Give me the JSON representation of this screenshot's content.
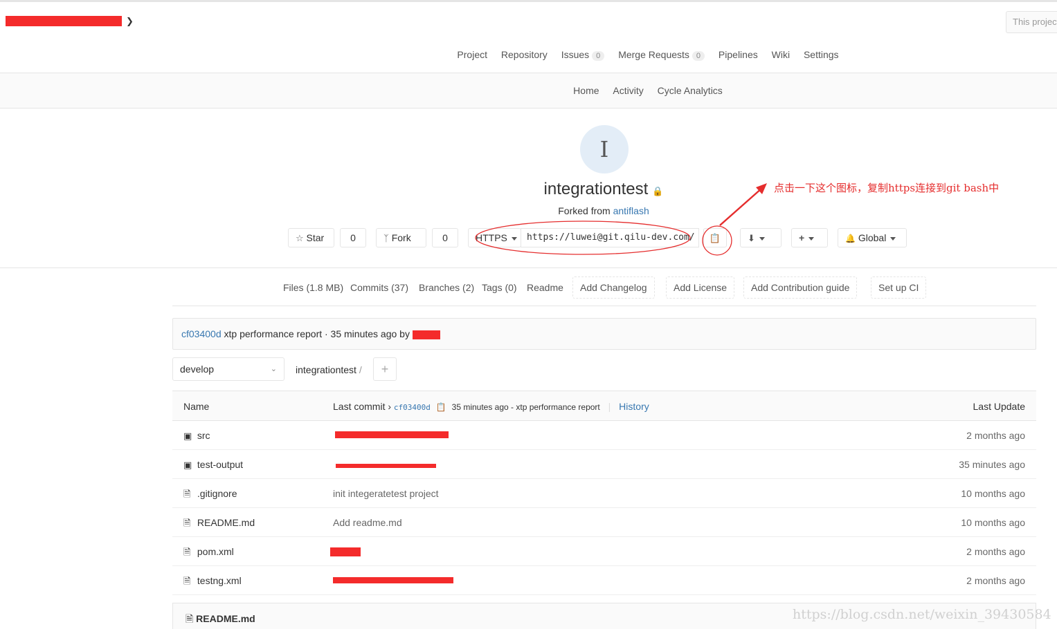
{
  "topbar": {
    "group_chevron_icon": "chevron-down-icon",
    "search_placeholder": "This project"
  },
  "project_nav": {
    "items": [
      {
        "label": "Project"
      },
      {
        "label": "Repository"
      },
      {
        "label": "Issues",
        "count": "0"
      },
      {
        "label": "Merge Requests",
        "count": "0"
      },
      {
        "label": "Pipelines"
      },
      {
        "label": "Wiki"
      },
      {
        "label": "Settings"
      }
    ]
  },
  "sub_nav": {
    "items": [
      {
        "label": "Home"
      },
      {
        "label": "Activity"
      },
      {
        "label": "Cycle Analytics"
      }
    ]
  },
  "project": {
    "avatar_letter": "I",
    "title": "integrationtest",
    "lock_icon": "lock-icon",
    "forked_prefix": "Forked from",
    "forked_source": "antiflash"
  },
  "actions": {
    "star_label": "Star",
    "star_count": "0",
    "fork_label": "Fork",
    "fork_count": "0",
    "protocol": "HTTPS",
    "clone_url": "https://luwei@git.qilu-dev.com/",
    "copy_icon": "clipboard-icon",
    "download_icon": "download-icon",
    "add_icon": "plus-icon",
    "notification_label": "Global",
    "notification_icon": "bell-icon"
  },
  "annotation": {
    "text": "点击一下这个图标，复制https连接到git bash中",
    "color": "#e52d2d"
  },
  "stats": {
    "files": "Files (1.8 MB)",
    "commits": "Commits (37)",
    "branches": "Branches (2)",
    "tags": "Tags (0)",
    "readme": "Readme",
    "add_changelog": "Add Changelog",
    "add_license": "Add License",
    "add_contribution": "Add Contribution guide",
    "setup_ci": "Set up CI"
  },
  "last_commit": {
    "sha": "cf03400d",
    "message": "xtp performance report · 35 minutes ago by"
  },
  "branch": {
    "name": "develop",
    "path": "integrationtest",
    "separator": "/"
  },
  "tree": {
    "headers": {
      "name": "Name",
      "last_commit": "Last commit",
      "sha": "cf03400d",
      "commit_info": "35 minutes ago - xtp performance report",
      "history": "History",
      "last_update": "Last Update"
    },
    "rows": [
      {
        "name": "src",
        "type": "folder",
        "message": "",
        "updated": "2 months ago"
      },
      {
        "name": "test-output",
        "type": "folder",
        "message": "",
        "updated": "35 minutes ago"
      },
      {
        "name": ".gitignore",
        "type": "file",
        "message": "init integeratetest project",
        "updated": "10 months ago"
      },
      {
        "name": "README.md",
        "type": "file",
        "message": "Add readme.md",
        "updated": "10 months ago"
      },
      {
        "name": "pom.xml",
        "type": "file",
        "message": "",
        "updated": "2 months ago"
      },
      {
        "name": "testng.xml",
        "type": "file",
        "message": "",
        "updated": "2 months ago"
      }
    ]
  },
  "readme": {
    "title": "README.md"
  },
  "watermark": "https://blog.csdn.net/weixin_39430584"
}
